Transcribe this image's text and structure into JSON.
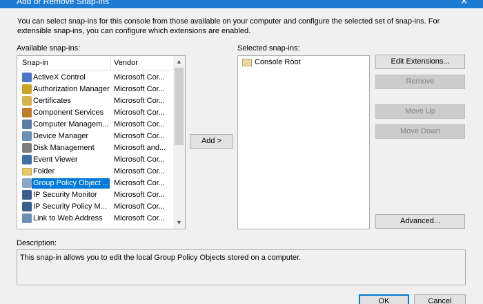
{
  "window": {
    "title": "Add or Remove Snap-ins",
    "close_glyph": "✕"
  },
  "intro_text": "You can select snap-ins for this console from those available on your computer and configure the selected set of snap-ins. For extensible snap-ins, you can configure which extensions are enabled.",
  "available": {
    "label": "Available snap-ins:",
    "columns": {
      "snapin": "Snap-in",
      "vendor": "Vendor"
    },
    "rows": [
      {
        "name": "ActiveX Control",
        "vendor": "Microsoft Cor...",
        "icon": "activex-icon"
      },
      {
        "name": "Authorization Manager",
        "vendor": "Microsoft Cor...",
        "icon": "authorization-icon"
      },
      {
        "name": "Certificates",
        "vendor": "Microsoft Cor...",
        "icon": "certificate-icon"
      },
      {
        "name": "Component Services",
        "vendor": "Microsoft Cor...",
        "icon": "component-services-icon"
      },
      {
        "name": "Computer Managem...",
        "vendor": "Microsoft Cor...",
        "icon": "computer-management-icon"
      },
      {
        "name": "Device Manager",
        "vendor": "Microsoft Cor...",
        "icon": "device-manager-icon"
      },
      {
        "name": "Disk Management",
        "vendor": "Microsoft and...",
        "icon": "disk-icon"
      },
      {
        "name": "Event Viewer",
        "vendor": "Microsoft Cor...",
        "icon": "event-viewer-icon"
      },
      {
        "name": "Folder",
        "vendor": "Microsoft Cor...",
        "icon": "folder-icon"
      },
      {
        "name": "Group Policy Object ...",
        "vendor": "Microsoft Cor...",
        "icon": "group-policy-icon",
        "selected": true
      },
      {
        "name": "IP Security Monitor",
        "vendor": "Microsoft Cor...",
        "icon": "ip-security-icon"
      },
      {
        "name": "IP Security Policy M...",
        "vendor": "Microsoft Cor...",
        "icon": "ip-security-policy-icon"
      },
      {
        "name": "Link to Web Address",
        "vendor": "Microsoft Cor...",
        "icon": "web-link-icon"
      }
    ]
  },
  "add_button": "Add >",
  "selected": {
    "label": "Selected snap-ins:",
    "items": [
      {
        "name": "Console Root",
        "icon": "folder-icon"
      }
    ]
  },
  "side_buttons": {
    "edit_extensions": "Edit Extensions...",
    "remove": "Remove",
    "move_up": "Move Up",
    "move_down": "Move Down",
    "advanced": "Advanced..."
  },
  "description": {
    "label": "Description:",
    "text": "This snap-in allows you to edit the local Group Policy Objects stored on a computer."
  },
  "footer": {
    "ok": "OK",
    "cancel": "Cancel"
  },
  "colors": {
    "titlebar": "#1e7bd4",
    "selection": "#0078d7",
    "dialog_bg": "#f0f0f0"
  }
}
